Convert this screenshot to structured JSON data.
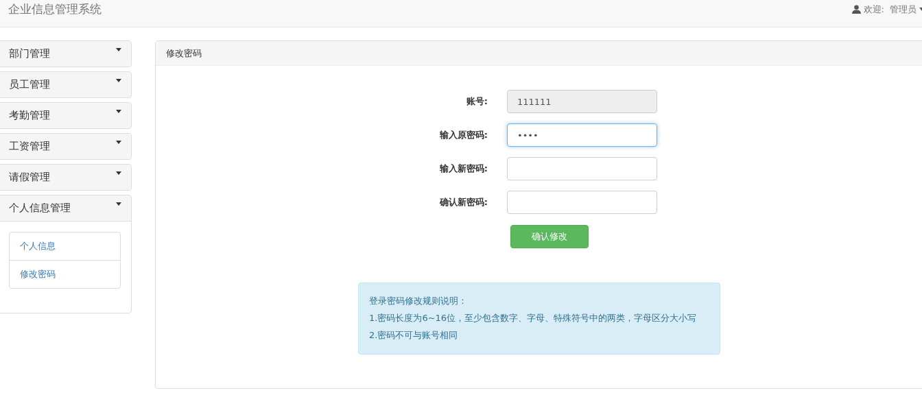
{
  "navbar": {
    "brand": "企业信息管理系统",
    "welcome": "欢迎:",
    "user": "管理员"
  },
  "sidebar": {
    "groups": [
      {
        "label": "部门管理",
        "expanded": false
      },
      {
        "label": "员工管理",
        "expanded": false
      },
      {
        "label": "考勤管理",
        "expanded": false
      },
      {
        "label": "工资管理",
        "expanded": false
      },
      {
        "label": "请假管理",
        "expanded": false
      },
      {
        "label": "个人信息管理",
        "expanded": true,
        "children": [
          {
            "label": "个人信息"
          },
          {
            "label": "修改密码"
          }
        ]
      }
    ]
  },
  "panel": {
    "title": "修改密码",
    "fields": [
      {
        "label": "账号:",
        "value": "111111",
        "disabled": true,
        "focused": false
      },
      {
        "label": "输入原密码:",
        "value": "••••",
        "disabled": false,
        "focused": true
      },
      {
        "label": "输入新密码:",
        "disabled": false,
        "focused": false
      },
      {
        "label": "确认新密码:",
        "disabled": false,
        "focused": false
      }
    ],
    "submit": "确认修改",
    "notice": {
      "title": "登录密码修改规则说明：",
      "rules": [
        "1.密码长度为6~16位，至少包含数字、字母、特殊符号中的两类，字母区分大小写",
        "2.密码不可与账号相同"
      ]
    }
  }
}
